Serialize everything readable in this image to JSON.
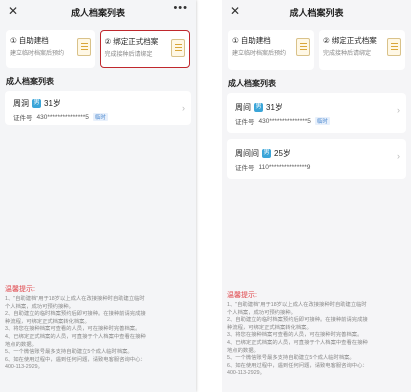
{
  "left": {
    "nav_title": "成人档案列表",
    "close_glyph": "✕",
    "more_glyph": "•••",
    "cards": [
      {
        "title": "① 自助建档",
        "sub": "建立临时档案后预约"
      },
      {
        "title": "② 绑定正式档案",
        "sub": "完成接种后请绑定"
      }
    ],
    "section_title": "成人档案列表",
    "records": [
      {
        "name": "周洞",
        "gender": "男",
        "age": "31岁",
        "id_label": "证件号",
        "id_value": "430***************5",
        "tag": "临时"
      }
    ],
    "tips_title": "温馨提示:",
    "tips": [
      "1、\"自助建档\"用于18岁以上成人在改接接种时自助建立临时",
      "个人档案，成功可预约接种。",
      "2、自助建立的临时档案预约后即可接种。在接种前请完成接",
      "种流程，可绑定正式档案转化档案。",
      "3、将您在接种档案可查看的人员，可在接种时完善档案。",
      "4、已绑定正式档案的人员，可直接于个人档案中查看在接种",
      "地点的数据。",
      "5、一个微信账号最多支持自助建立5个成人临时档案。",
      "6、如在使用过程中，遇到任何问题，请致电客服咨询中心：",
      "400-113-2929。"
    ]
  },
  "right": {
    "nav_title": "成人档案列表",
    "close_glyph": "✕",
    "cards": [
      {
        "title": "① 自助建档",
        "sub": "建立临时档案后预约"
      },
      {
        "title": "② 绑定正式档案",
        "sub": "完成接种后请绑定"
      }
    ],
    "section_title": "成人档案列表",
    "records": [
      {
        "name": "周间",
        "gender": "男",
        "age": "31岁",
        "id_label": "证件号",
        "id_value": "430***************5",
        "tag": "临时"
      },
      {
        "name": "周间间",
        "gender": "男",
        "age": "25岁",
        "id_label": "证件号",
        "id_value": "110***************9",
        "tag": ""
      }
    ],
    "tips_title": "温馨提示:",
    "tips": [
      "1、\"自助建档\"用于18岁以上成人在改接接种时自助建立临时",
      "个人档案，成功可预约接种。",
      "2、自助建立的临时档案预约后即可接种。在接种前请完成接",
      "种流程，可绑定正式档案转化档案。",
      "3、将您在接种档案可查看的人员，可在接种时完善档案。",
      "4、已绑定正式档案的人员，可直接于个人档案中查看在接种",
      "地点的数据。",
      "5、一个微信账号最多支持自助建立5个成人临时档案。",
      "6、如在使用过程中，遇到任何问题，请致电客服咨询中心：",
      "400-113-2929。"
    ]
  },
  "colors": {
    "highlight_border": "#c0282d",
    "tips_title": "#e0454a",
    "gender_badge": "#3aa5d8",
    "temp_tag": "#4a88d0"
  }
}
